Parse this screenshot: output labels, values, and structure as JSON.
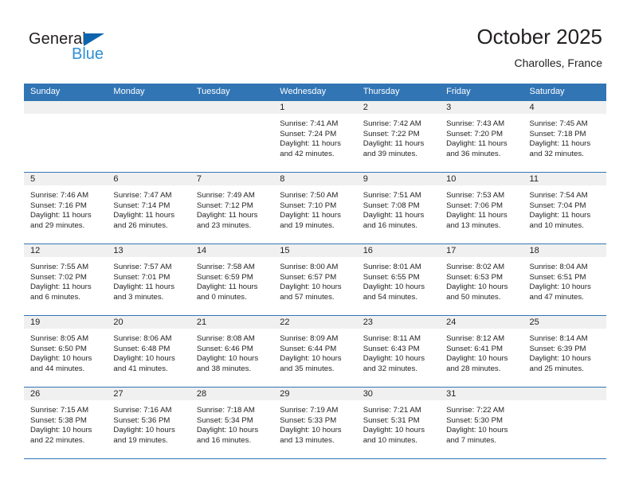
{
  "brand": {
    "name_top": "General",
    "name_bottom": "Blue",
    "triangle_color": "#0d64ad",
    "blue_text_color": "#2e8fd6"
  },
  "header": {
    "title": "October 2025",
    "location": "Charolles, France"
  },
  "theme": {
    "header_blue": "#3175b5",
    "daynum_band": "#f0f0f0",
    "text": "#231f20",
    "page_background": "#ffffff"
  },
  "calendar": {
    "weekdays": [
      "Sunday",
      "Monday",
      "Tuesday",
      "Wednesday",
      "Thursday",
      "Friday",
      "Saturday"
    ],
    "weeks": [
      [
        {
          "day": "",
          "sunrise": "",
          "sunset": "",
          "daylight_line1": "",
          "daylight_line2": "",
          "empty": true
        },
        {
          "day": "",
          "sunrise": "",
          "sunset": "",
          "daylight_line1": "",
          "daylight_line2": "",
          "empty": true
        },
        {
          "day": "",
          "sunrise": "",
          "sunset": "",
          "daylight_line1": "",
          "daylight_line2": "",
          "empty": true
        },
        {
          "day": "1",
          "sunrise": "Sunrise: 7:41 AM",
          "sunset": "Sunset: 7:24 PM",
          "daylight_line1": "Daylight: 11 hours",
          "daylight_line2": "and 42 minutes.",
          "empty": false
        },
        {
          "day": "2",
          "sunrise": "Sunrise: 7:42 AM",
          "sunset": "Sunset: 7:22 PM",
          "daylight_line1": "Daylight: 11 hours",
          "daylight_line2": "and 39 minutes.",
          "empty": false
        },
        {
          "day": "3",
          "sunrise": "Sunrise: 7:43 AM",
          "sunset": "Sunset: 7:20 PM",
          "daylight_line1": "Daylight: 11 hours",
          "daylight_line2": "and 36 minutes.",
          "empty": false
        },
        {
          "day": "4",
          "sunrise": "Sunrise: 7:45 AM",
          "sunset": "Sunset: 7:18 PM",
          "daylight_line1": "Daylight: 11 hours",
          "daylight_line2": "and 32 minutes.",
          "empty": false
        }
      ],
      [
        {
          "day": "5",
          "sunrise": "Sunrise: 7:46 AM",
          "sunset": "Sunset: 7:16 PM",
          "daylight_line1": "Daylight: 11 hours",
          "daylight_line2": "and 29 minutes.",
          "empty": false
        },
        {
          "day": "6",
          "sunrise": "Sunrise: 7:47 AM",
          "sunset": "Sunset: 7:14 PM",
          "daylight_line1": "Daylight: 11 hours",
          "daylight_line2": "and 26 minutes.",
          "empty": false
        },
        {
          "day": "7",
          "sunrise": "Sunrise: 7:49 AM",
          "sunset": "Sunset: 7:12 PM",
          "daylight_line1": "Daylight: 11 hours",
          "daylight_line2": "and 23 minutes.",
          "empty": false
        },
        {
          "day": "8",
          "sunrise": "Sunrise: 7:50 AM",
          "sunset": "Sunset: 7:10 PM",
          "daylight_line1": "Daylight: 11 hours",
          "daylight_line2": "and 19 minutes.",
          "empty": false
        },
        {
          "day": "9",
          "sunrise": "Sunrise: 7:51 AM",
          "sunset": "Sunset: 7:08 PM",
          "daylight_line1": "Daylight: 11 hours",
          "daylight_line2": "and 16 minutes.",
          "empty": false
        },
        {
          "day": "10",
          "sunrise": "Sunrise: 7:53 AM",
          "sunset": "Sunset: 7:06 PM",
          "daylight_line1": "Daylight: 11 hours",
          "daylight_line2": "and 13 minutes.",
          "empty": false
        },
        {
          "day": "11",
          "sunrise": "Sunrise: 7:54 AM",
          "sunset": "Sunset: 7:04 PM",
          "daylight_line1": "Daylight: 11 hours",
          "daylight_line2": "and 10 minutes.",
          "empty": false
        }
      ],
      [
        {
          "day": "12",
          "sunrise": "Sunrise: 7:55 AM",
          "sunset": "Sunset: 7:02 PM",
          "daylight_line1": "Daylight: 11 hours",
          "daylight_line2": "and 6 minutes.",
          "empty": false
        },
        {
          "day": "13",
          "sunrise": "Sunrise: 7:57 AM",
          "sunset": "Sunset: 7:01 PM",
          "daylight_line1": "Daylight: 11 hours",
          "daylight_line2": "and 3 minutes.",
          "empty": false
        },
        {
          "day": "14",
          "sunrise": "Sunrise: 7:58 AM",
          "sunset": "Sunset: 6:59 PM",
          "daylight_line1": "Daylight: 11 hours",
          "daylight_line2": "and 0 minutes.",
          "empty": false
        },
        {
          "day": "15",
          "sunrise": "Sunrise: 8:00 AM",
          "sunset": "Sunset: 6:57 PM",
          "daylight_line1": "Daylight: 10 hours",
          "daylight_line2": "and 57 minutes.",
          "empty": false
        },
        {
          "day": "16",
          "sunrise": "Sunrise: 8:01 AM",
          "sunset": "Sunset: 6:55 PM",
          "daylight_line1": "Daylight: 10 hours",
          "daylight_line2": "and 54 minutes.",
          "empty": false
        },
        {
          "day": "17",
          "sunrise": "Sunrise: 8:02 AM",
          "sunset": "Sunset: 6:53 PM",
          "daylight_line1": "Daylight: 10 hours",
          "daylight_line2": "and 50 minutes.",
          "empty": false
        },
        {
          "day": "18",
          "sunrise": "Sunrise: 8:04 AM",
          "sunset": "Sunset: 6:51 PM",
          "daylight_line1": "Daylight: 10 hours",
          "daylight_line2": "and 47 minutes.",
          "empty": false
        }
      ],
      [
        {
          "day": "19",
          "sunrise": "Sunrise: 8:05 AM",
          "sunset": "Sunset: 6:50 PM",
          "daylight_line1": "Daylight: 10 hours",
          "daylight_line2": "and 44 minutes.",
          "empty": false
        },
        {
          "day": "20",
          "sunrise": "Sunrise: 8:06 AM",
          "sunset": "Sunset: 6:48 PM",
          "daylight_line1": "Daylight: 10 hours",
          "daylight_line2": "and 41 minutes.",
          "empty": false
        },
        {
          "day": "21",
          "sunrise": "Sunrise: 8:08 AM",
          "sunset": "Sunset: 6:46 PM",
          "daylight_line1": "Daylight: 10 hours",
          "daylight_line2": "and 38 minutes.",
          "empty": false
        },
        {
          "day": "22",
          "sunrise": "Sunrise: 8:09 AM",
          "sunset": "Sunset: 6:44 PM",
          "daylight_line1": "Daylight: 10 hours",
          "daylight_line2": "and 35 minutes.",
          "empty": false
        },
        {
          "day": "23",
          "sunrise": "Sunrise: 8:11 AM",
          "sunset": "Sunset: 6:43 PM",
          "daylight_line1": "Daylight: 10 hours",
          "daylight_line2": "and 32 minutes.",
          "empty": false
        },
        {
          "day": "24",
          "sunrise": "Sunrise: 8:12 AM",
          "sunset": "Sunset: 6:41 PM",
          "daylight_line1": "Daylight: 10 hours",
          "daylight_line2": "and 28 minutes.",
          "empty": false
        },
        {
          "day": "25",
          "sunrise": "Sunrise: 8:14 AM",
          "sunset": "Sunset: 6:39 PM",
          "daylight_line1": "Daylight: 10 hours",
          "daylight_line2": "and 25 minutes.",
          "empty": false
        }
      ],
      [
        {
          "day": "26",
          "sunrise": "Sunrise: 7:15 AM",
          "sunset": "Sunset: 5:38 PM",
          "daylight_line1": "Daylight: 10 hours",
          "daylight_line2": "and 22 minutes.",
          "empty": false
        },
        {
          "day": "27",
          "sunrise": "Sunrise: 7:16 AM",
          "sunset": "Sunset: 5:36 PM",
          "daylight_line1": "Daylight: 10 hours",
          "daylight_line2": "and 19 minutes.",
          "empty": false
        },
        {
          "day": "28",
          "sunrise": "Sunrise: 7:18 AM",
          "sunset": "Sunset: 5:34 PM",
          "daylight_line1": "Daylight: 10 hours",
          "daylight_line2": "and 16 minutes.",
          "empty": false
        },
        {
          "day": "29",
          "sunrise": "Sunrise: 7:19 AM",
          "sunset": "Sunset: 5:33 PM",
          "daylight_line1": "Daylight: 10 hours",
          "daylight_line2": "and 13 minutes.",
          "empty": false
        },
        {
          "day": "30",
          "sunrise": "Sunrise: 7:21 AM",
          "sunset": "Sunset: 5:31 PM",
          "daylight_line1": "Daylight: 10 hours",
          "daylight_line2": "and 10 minutes.",
          "empty": false
        },
        {
          "day": "31",
          "sunrise": "Sunrise: 7:22 AM",
          "sunset": "Sunset: 5:30 PM",
          "daylight_line1": "Daylight: 10 hours",
          "daylight_line2": "and 7 minutes.",
          "empty": false
        },
        {
          "day": "",
          "sunrise": "",
          "sunset": "",
          "daylight_line1": "",
          "daylight_line2": "",
          "empty": true
        }
      ]
    ]
  }
}
